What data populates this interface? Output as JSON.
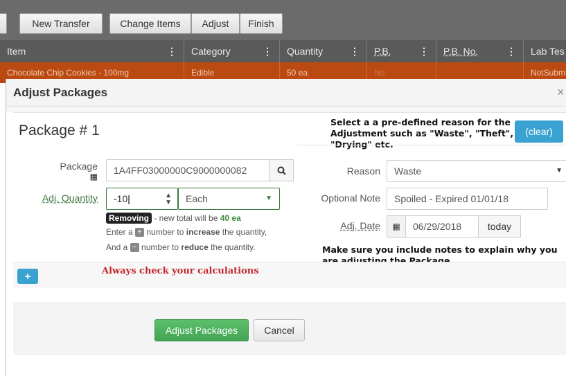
{
  "toolbar": {
    "new_transfer": "New Transfer",
    "change_items": "Change Items",
    "adjust": "Adjust",
    "finish": "Finish"
  },
  "grid": {
    "columns": [
      "Item",
      "Category",
      "Quantity",
      "P.B.",
      "P.B. No.",
      "Lab Tes"
    ],
    "row": {
      "item": "Chocolate Chip Cookies - 100mg",
      "category": "Edible",
      "quantity": "50 ea",
      "pb": "No",
      "lab": "NotSubm"
    }
  },
  "modal": {
    "title": "Adjust Packages",
    "close": "×",
    "package_title": "Package # 1",
    "package_label": "Package",
    "package_value": "1A4FF03000000C9000000082",
    "adj_qty_label": "Adj. Quantity",
    "adj_qty_value": "-10",
    "unit_value": "Each",
    "removing_badge": "Removing",
    "new_total_text": " - new total will be ",
    "new_total_value": "40 ea",
    "hint1_pre": "Enter a ",
    "hint1_mid": " number to ",
    "hint1_bold": "increase",
    "hint1_post": " the quantity,",
    "hint2_pre": "And a ",
    "hint2_mid": " number to ",
    "hint2_bold": "reduce",
    "hint2_post": " the quantity.",
    "reason_label": "Reason",
    "reason_value": "Waste",
    "note_label": "Optional Note",
    "note_value": "Spoiled - Expired 01/01/18",
    "date_label": "Adj. Date",
    "date_value": "06/29/2018",
    "today_btn": "today",
    "clear_btn": "(clear)",
    "adjust_btn": "Adjust Packages",
    "cancel_btn": "Cancel"
  },
  "annotations": {
    "reason_line1": "Select a a pre-defined reason for the",
    "reason_line2": "Adjustment such as \"Waste\", \"Theft\",",
    "reason_line3": "\"Drying\" etc.",
    "notes_line1": "Make sure you include notes to explain why you",
    "notes_line2": "are adjusting the Package",
    "calc": "Always check your calculations"
  },
  "colors": {
    "row_selected": "#bb4a12",
    "accent_blue": "#3aa2d0",
    "success_green": "#4cae5c",
    "warning_red": "#c0272d",
    "adj_qty_border": "#3c763d"
  }
}
